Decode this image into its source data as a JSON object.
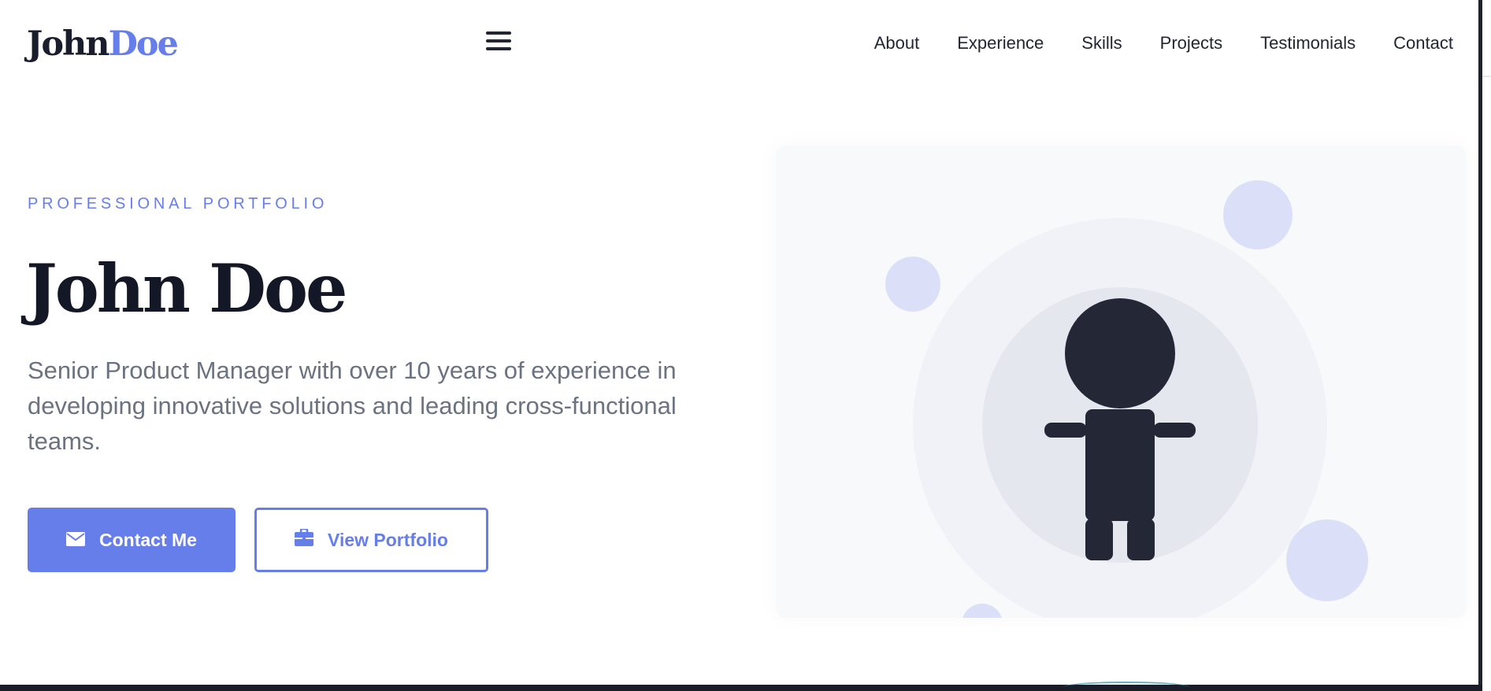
{
  "header": {
    "logo_first": "John",
    "logo_last": "Doe",
    "menu_icon": "hamburger-menu-icon",
    "nav": [
      {
        "label": "About"
      },
      {
        "label": "Experience"
      },
      {
        "label": "Skills"
      },
      {
        "label": "Projects"
      },
      {
        "label": "Testimonials"
      },
      {
        "label": "Contact"
      }
    ]
  },
  "hero": {
    "eyebrow": "PROFESSIONAL PORTFOLIO",
    "title": "John Doe",
    "description": "Senior Product Manager with over 10 years of experience in developing innovative solutions and leading cross-functional teams.",
    "primary_button": {
      "label": "Contact Me",
      "icon": "envelope-icon"
    },
    "secondary_button": {
      "label": "View Portfolio",
      "icon": "briefcase-icon"
    }
  },
  "colors": {
    "accent": "#667eea",
    "heading": "#141826",
    "body_text": "#6b7280",
    "figure": "#222633"
  },
  "illustration": {
    "icon": "person-figure-icon"
  }
}
